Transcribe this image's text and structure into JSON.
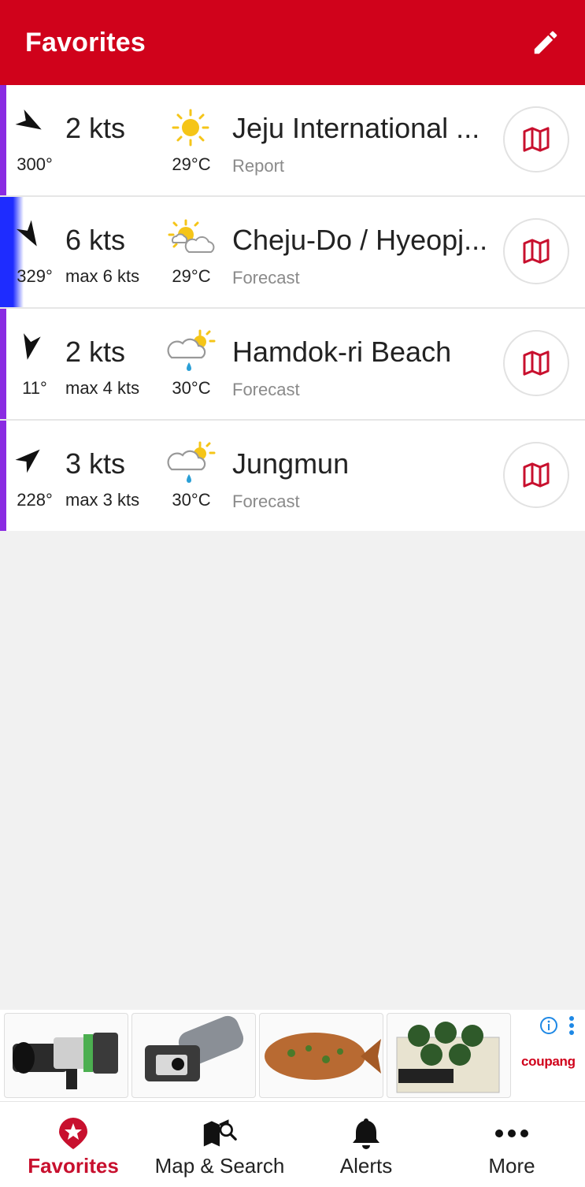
{
  "header": {
    "title": "Favorites",
    "edit_icon": "pencil-icon"
  },
  "favorites": [
    {
      "direction_deg": 300,
      "direction_label": "300°",
      "speed": "2 kts",
      "max": "",
      "weather_icon": "sunny-icon",
      "temp": "29°C",
      "name": "Jeju International ...",
      "kind": "Report",
      "stripe_color": "#8a2be2"
    },
    {
      "direction_deg": 329,
      "direction_label": "329°",
      "speed": "6 kts",
      "max": "max 6 kts",
      "weather_icon": "sun-cloud-icon",
      "temp": "29°C",
      "name": "Cheju-Do / Hyeopj...",
      "kind": "Forecast",
      "stripe_color": "#1e2cff"
    },
    {
      "direction_deg": 11,
      "direction_label": "11°",
      "speed": "2 kts",
      "max": "max 4 kts",
      "weather_icon": "cloud-sun-rain-icon",
      "temp": "30°C",
      "name": "Hamdok-ri Beach",
      "kind": "Forecast",
      "stripe_color": "#8a2be2"
    },
    {
      "direction_deg": 228,
      "direction_label": "228°",
      "speed": "3 kts",
      "max": "max 3 kts",
      "weather_icon": "cloud-sun-rain-icon",
      "temp": "30°C",
      "name": "Jungmun",
      "kind": "Forecast",
      "stripe_color": "#8a2be2"
    }
  ],
  "ad": {
    "brand": "coupang",
    "info_icon": "info-icon",
    "menu_icon": "vertical-dots-icon",
    "items": [
      "telescope-finder-image",
      "microscope-image",
      "grilled-fish-image",
      "plant-balls-image"
    ]
  },
  "tabs": [
    {
      "label": "Favorites",
      "icon": "star-pin-icon",
      "active": true
    },
    {
      "label": "Map & Search",
      "icon": "map-search-icon",
      "active": false
    },
    {
      "label": "Alerts",
      "icon": "bell-icon",
      "active": false
    },
    {
      "label": "More",
      "icon": "more-dots-icon",
      "active": false
    }
  ]
}
